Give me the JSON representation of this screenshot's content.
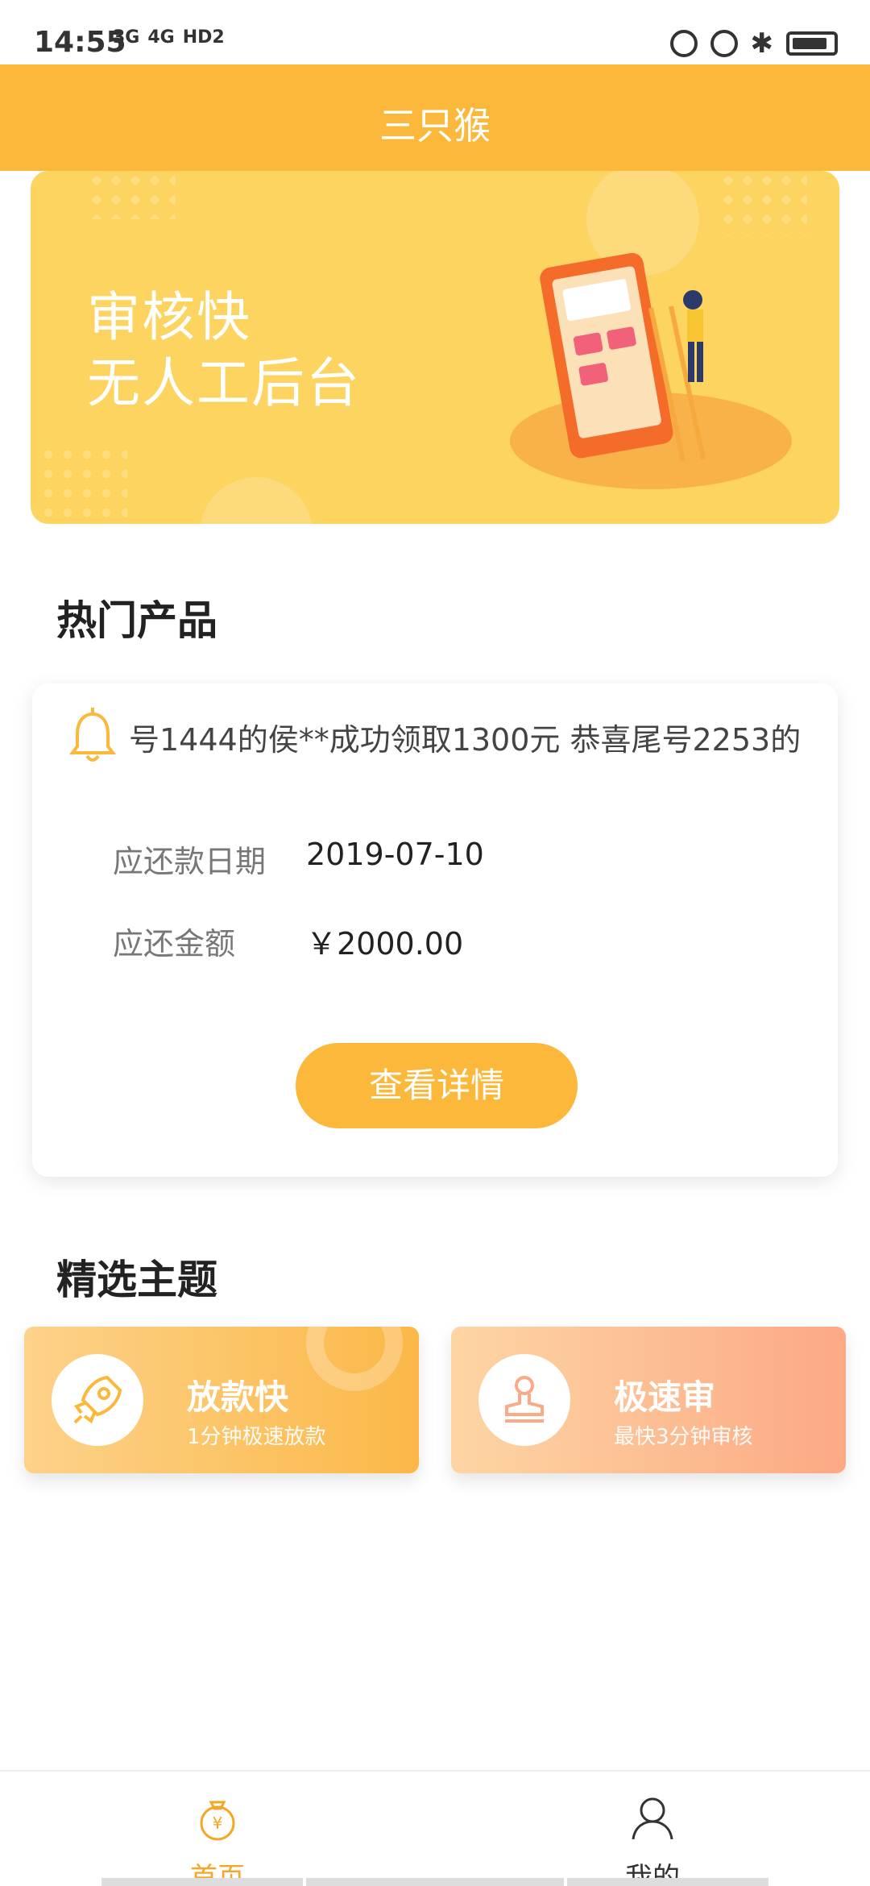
{
  "status_bar": {
    "time": "14:55",
    "signals": [
      "3G",
      "4G",
      "HD2"
    ]
  },
  "header": {
    "title": "三只猴"
  },
  "banner": {
    "line1": "审核快",
    "line2": "无人工后台"
  },
  "hot_products": {
    "title": "热门产品",
    "marquee": "号1444的侯**成功领取1300元 恭喜尾号2253的",
    "rows": [
      {
        "label": "应还款日期",
        "value": "2019-07-10"
      },
      {
        "label": "应还金额",
        "value": "￥2000.00"
      }
    ],
    "detail_button": "查看详情"
  },
  "featured": {
    "title": "精选主题",
    "cards": [
      {
        "title": "放款快",
        "subtitle": "1分钟极速放款",
        "icon": "rocket-icon"
      },
      {
        "title": "极速审",
        "subtitle": "最快3分钟审核",
        "icon": "stamp-icon"
      }
    ]
  },
  "bottom_nav": {
    "items": [
      {
        "label": "首页",
        "icon": "money-bag-icon",
        "active": true
      },
      {
        "label": "我的",
        "icon": "user-icon",
        "active": false
      }
    ]
  },
  "colors": {
    "primary": "#fbb83a",
    "banner": "#fdd460",
    "active_nav": "#f5a623",
    "inactive_nav": "#333333"
  }
}
